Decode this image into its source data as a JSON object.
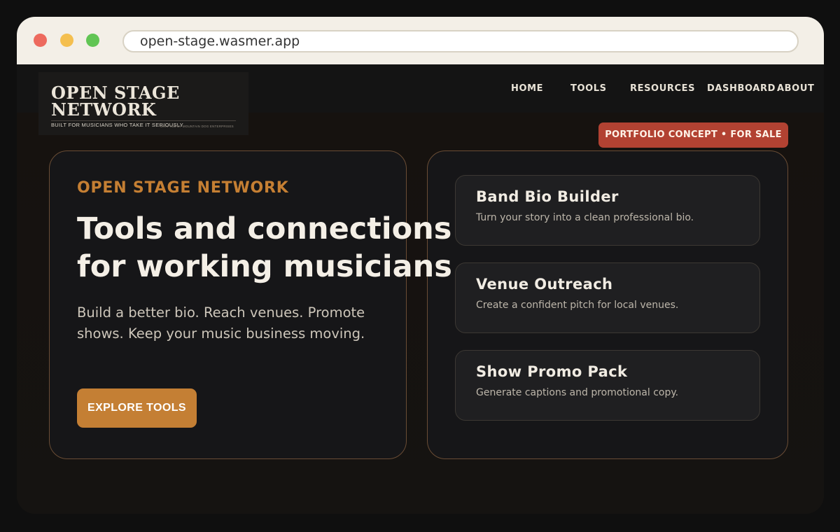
{
  "browser": {
    "url": "open-stage.wasmer.app"
  },
  "logo": {
    "title": "OPEN STAGE NETWORK",
    "tagline": "BUILT FOR MUSICIANS WHO TAKE IT SERIOUSLY",
    "credit": "CRAFTED BY MOUNTAIN DOG ENTERPRISES"
  },
  "nav": {
    "items": [
      "HOME",
      "TOOLS",
      "RESOURCES",
      "DASHBOARD",
      "ABOUT"
    ]
  },
  "badge": {
    "label": "PORTFOLIO CONCEPT • FOR SALE"
  },
  "hero": {
    "eyebrow": "OPEN STAGE NETWORK",
    "headline_line1": "Tools and connections",
    "headline_line2": "for working musicians",
    "subtext": "Build a better bio. Reach venues. Promote shows. Keep your music business moving.",
    "cta_label": "EXPLORE TOOLS"
  },
  "tools": [
    {
      "title": "Band Bio Builder",
      "description": "Turn your story into a clean professional bio."
    },
    {
      "title": "Venue Outreach",
      "description": "Create a confident pitch for local venues."
    },
    {
      "title": "Show Promo Pack",
      "description": "Generate captions and promotional copy."
    }
  ],
  "colors": {
    "accent": "#c47f34",
    "badge": "#b24232",
    "background": "#141414",
    "card_border": "#6a4d35"
  }
}
